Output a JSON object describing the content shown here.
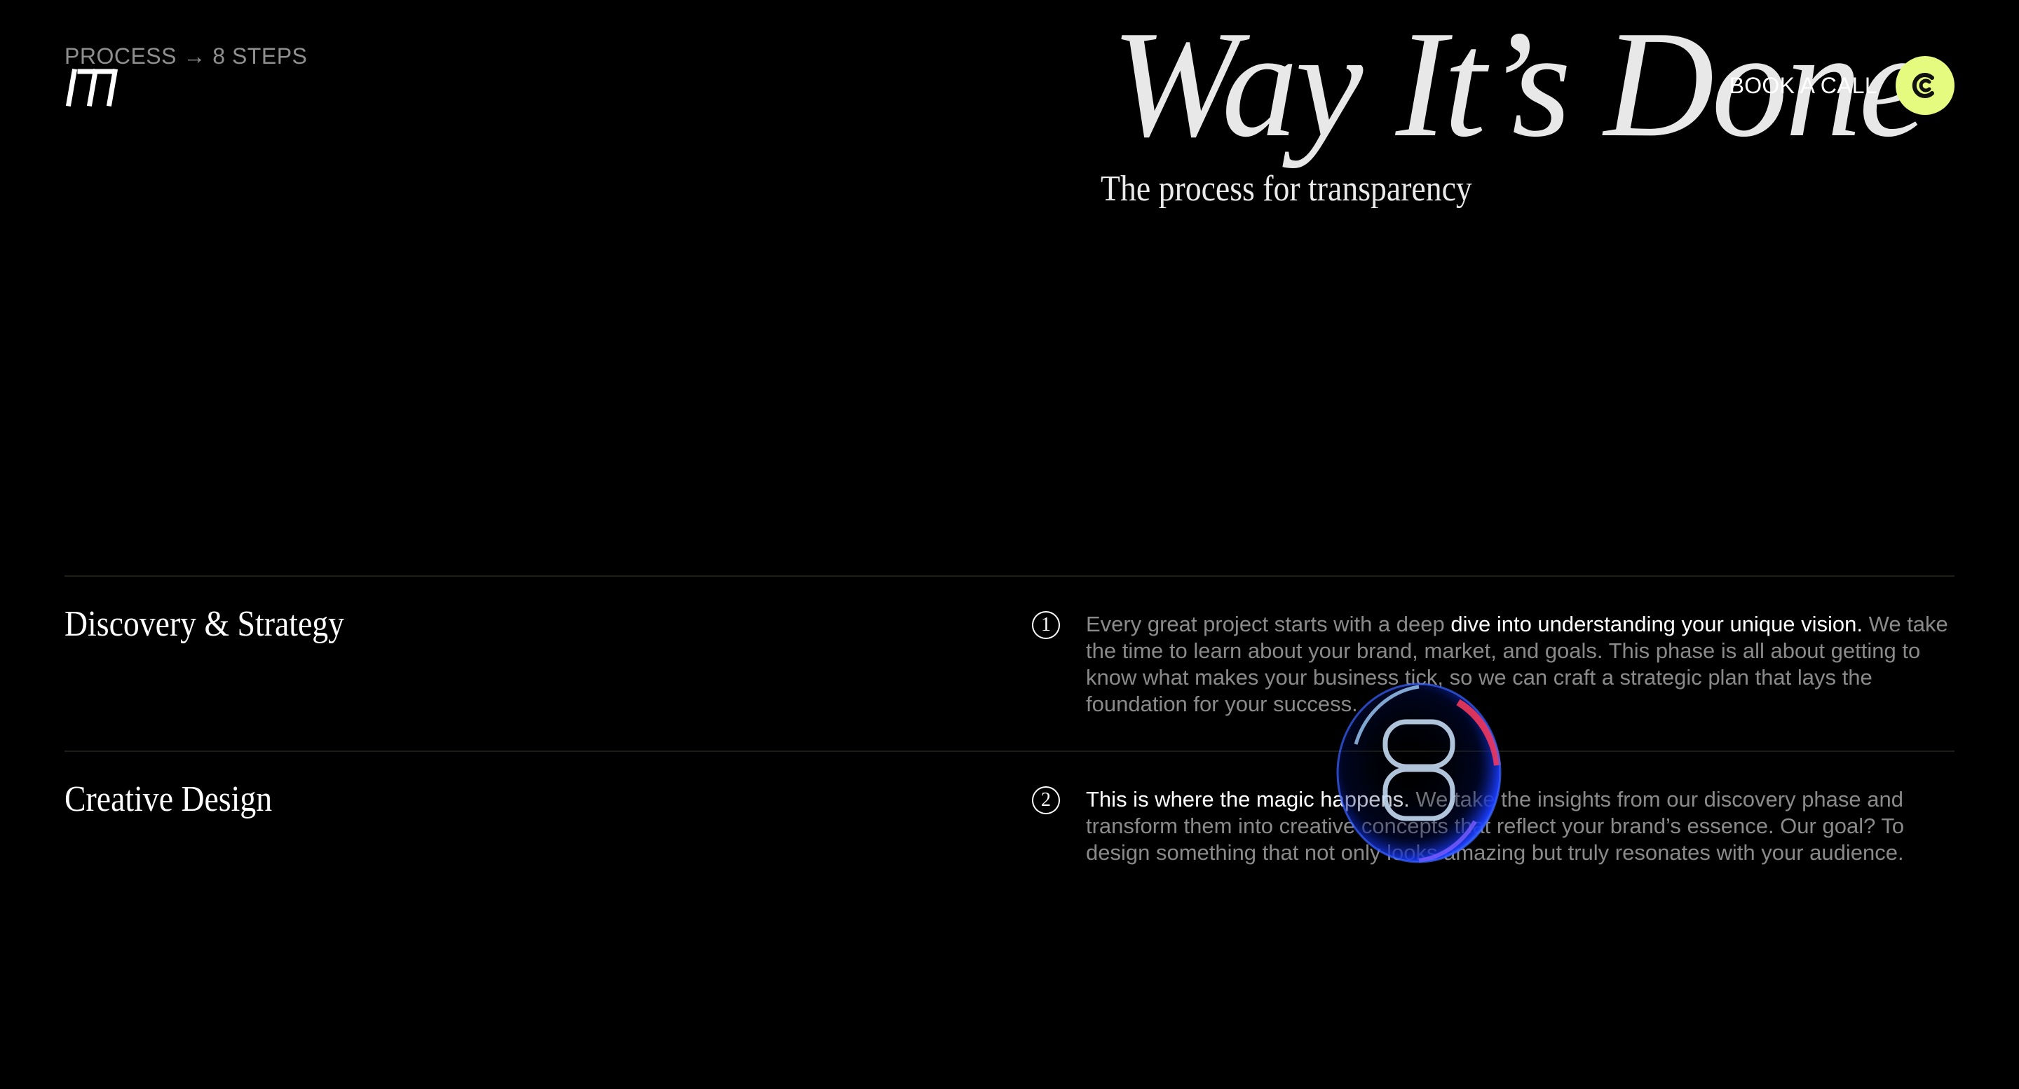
{
  "header": {
    "eyebrow": "PROCESS → 8 STEPS",
    "logo_icon": "slash-mark-logo",
    "book_call_label": "BOOK A CALL",
    "book_call_icon": "calendly-icon",
    "accent_color": "#e4fb7f"
  },
  "hero": {
    "title": "Way It’s Done",
    "subtitle": "The process for transparency"
  },
  "steps": [
    {
      "number": "1",
      "title": "Discovery & Strategy",
      "text_before": "Every great project starts with a deep ",
      "highlight": "dive into understanding your unique vision.",
      "text_after": " We take the time to learn about your brand, market, and goals. This phase is all about getting to know what makes your business tick, so we can craft a strategic plan that lays the foundation for your success."
    },
    {
      "number": "2",
      "title": "Creative Design",
      "text_before": "",
      "highlight": "This is where the magic happens.",
      "text_after": " We take the insights from our discovery phase and transform them into creative concepts that reflect your brand’s essence. Our goal? To design something that not only looks amazing but truly resonates with your audience."
    }
  ]
}
